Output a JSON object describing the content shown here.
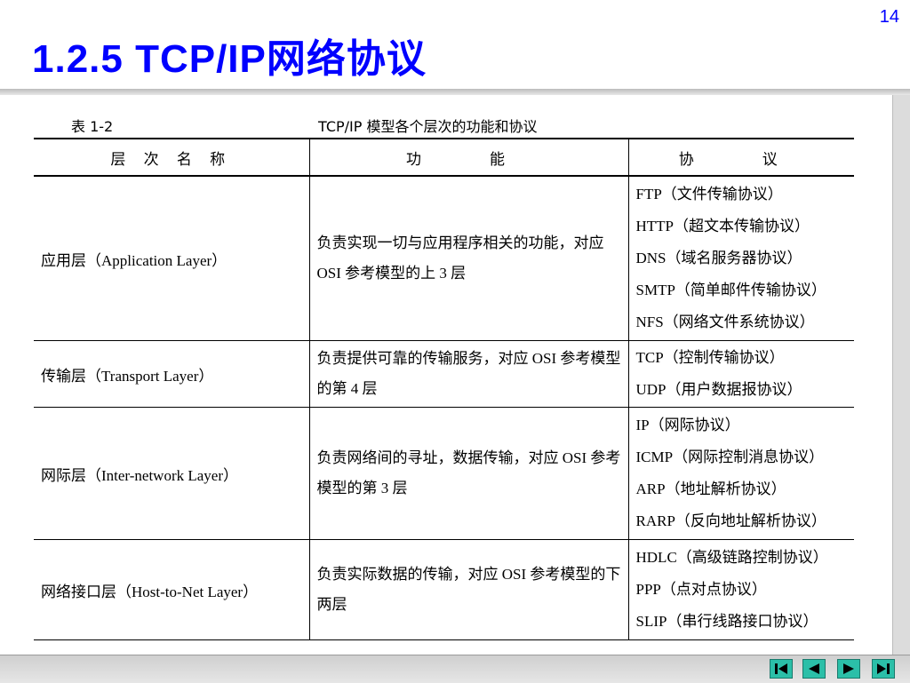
{
  "slide": {
    "page_number": "14",
    "title": "1.2.5  TCP/IP网络协议"
  },
  "document": {
    "table_label": "表 1-2",
    "table_title": "TCP/IP 模型各个层次的功能和协议",
    "headers": [
      "层 次 名 称",
      "功　能",
      "协　议"
    ],
    "rows": [
      {
        "layer": "应用层（Application Layer）",
        "function": "负责实现一切与应用程序相关的功能，对应 OSI 参考模型的上 3 层",
        "protocols": [
          "FTP（文件传输协议）",
          "HTTP（超文本传输协议）",
          "DNS（域名服务器协议）",
          "SMTP（简单邮件传输协议）",
          "NFS（网络文件系统协议）"
        ]
      },
      {
        "layer": "传输层（Transport Layer）",
        "function": "负责提供可靠的传输服务，对应 OSI 参考模型的第 4 层",
        "protocols": [
          "TCP（控制传输协议）",
          "UDP（用户数据报协议）"
        ]
      },
      {
        "layer": "网际层（Inter-network Layer）",
        "function": "负责网络间的寻址，数据传输，对应 OSI 参考模型的第 3 层",
        "protocols": [
          "IP（网际协议）",
          "ICMP（网际控制消息协议）",
          "ARP（地址解析协议）",
          "RARP（反向地址解析协议）"
        ]
      },
      {
        "layer": "网络接口层（Host-to-Net Layer）",
        "function": "负责实际数据的传输，对应 OSI 参考模型的下两层",
        "protocols": [
          "HDLC（高级链路控制协议）",
          "PPP（点对点协议）",
          "SLIP（串行线路接口协议）"
        ]
      }
    ]
  },
  "navigation": {
    "icons": [
      "first-slide-icon",
      "previous-slide-icon",
      "next-slide-icon",
      "last-slide-icon"
    ],
    "button_color": "#2bbfa8"
  },
  "colors": {
    "title": "#0000ff"
  }
}
